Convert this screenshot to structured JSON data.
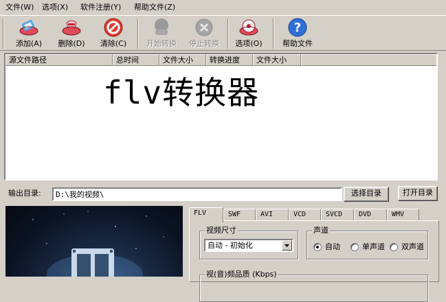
{
  "menu": [
    {
      "label": "文件(W)"
    },
    {
      "label": "选项(X)"
    },
    {
      "label": "软件注册(Y)"
    },
    {
      "label": "帮助文件(Z)"
    }
  ],
  "toolbar": {
    "add": {
      "label": "添加(A)",
      "icon": "add-file-icon"
    },
    "delete": {
      "label": "删除(D)",
      "icon": "delete-file-icon"
    },
    "clear": {
      "label": "清除(C)",
      "icon": "clear-icon"
    },
    "start": {
      "label": "开始转换",
      "icon": "start-convert-icon",
      "disabled": true
    },
    "stop": {
      "label": "停止转换",
      "icon": "stop-convert-icon",
      "disabled": true
    },
    "options": {
      "label": "选项(O)",
      "icon": "options-disc-icon"
    },
    "help": {
      "label": "帮助文件",
      "icon": "help-icon"
    }
  },
  "list": {
    "columns": [
      "源文件路径",
      "总时间",
      "文件大小",
      "转换进度",
      "文件大小"
    ],
    "watermark": "flv转换器",
    "rows": []
  },
  "output": {
    "label": "输出目录:",
    "path": "D:\\我的视频\\",
    "browse_label": "选择目录",
    "open_label": "打开目录"
  },
  "tabs": [
    "FLV",
    "SWF",
    "AVI",
    "VCD",
    "SVCD",
    "DVD",
    "WMV"
  ],
  "active_tab": "FLV",
  "video_size": {
    "title": "视频尺寸",
    "selected": "自动 - 初始化"
  },
  "audio_channel": {
    "title": "声道",
    "options": [
      "自动",
      "单声道",
      "双声道"
    ],
    "selected": "自动"
  },
  "quality": {
    "title": "视(音)频品质 (Kbps)"
  },
  "colors": {
    "window_bg": "#d4d0c8",
    "shadow": "#808080",
    "highlight": "#ffffff"
  }
}
